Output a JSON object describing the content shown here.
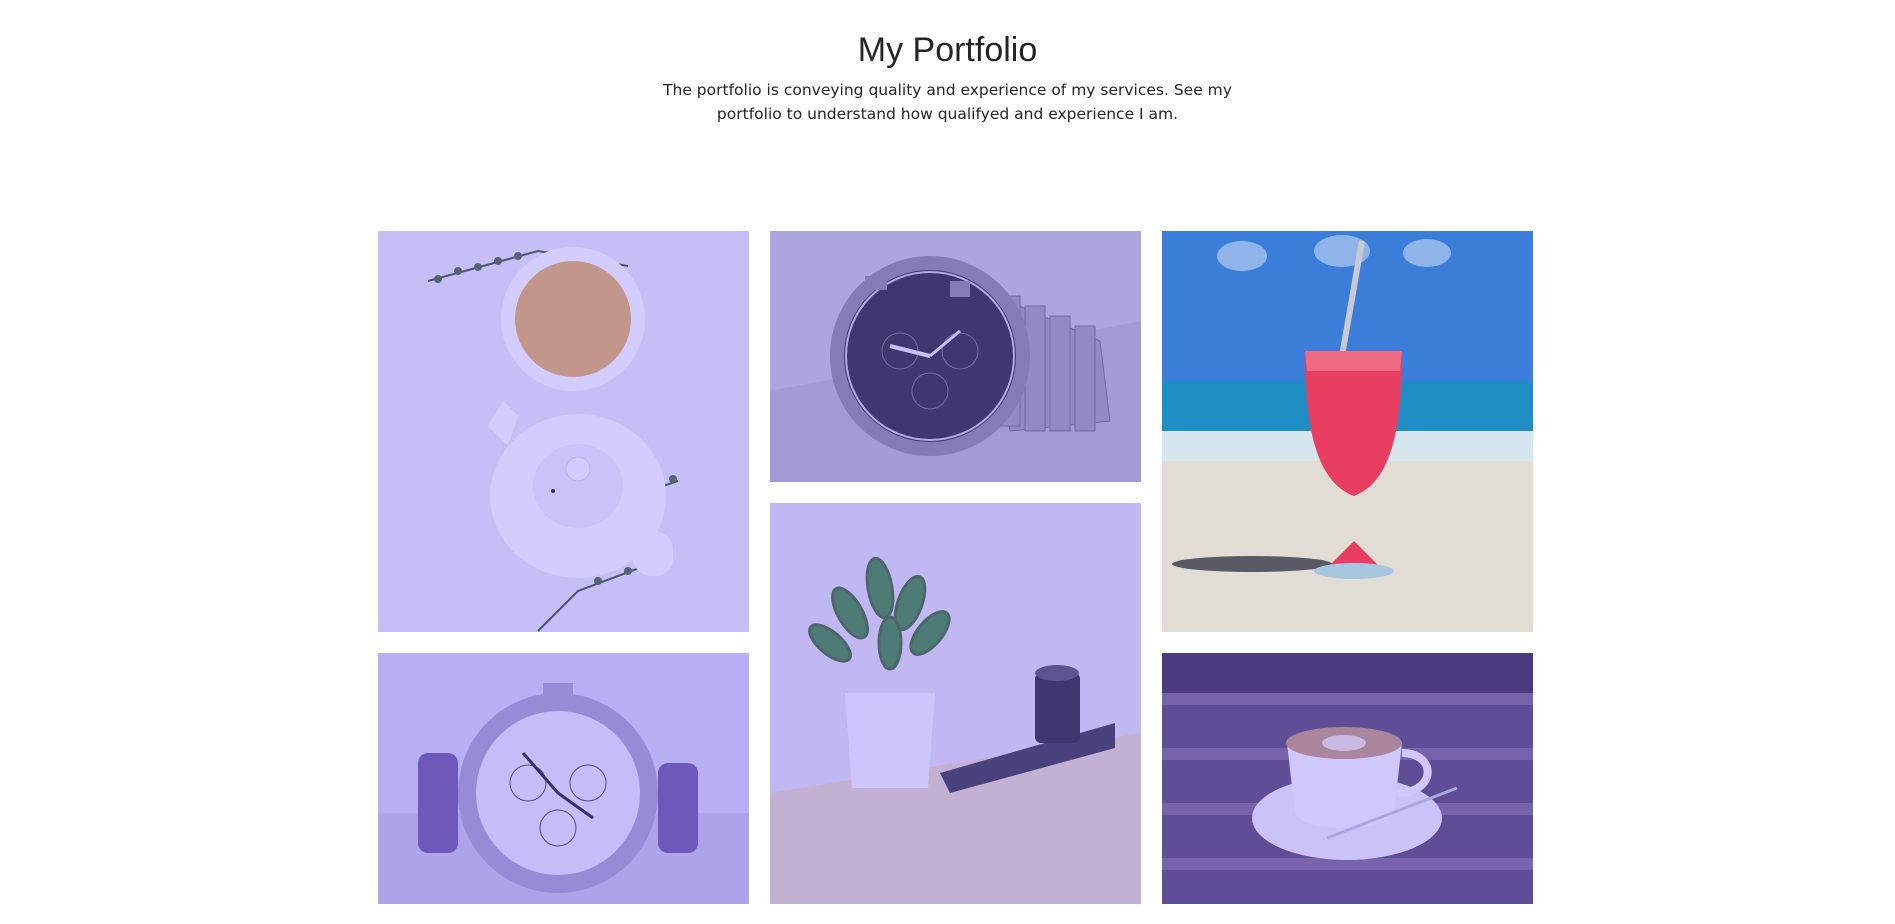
{
  "portfolio": {
    "title": "My Portfolio",
    "description": "The portfolio is conveying quality and experience of my services. See my portfolio to understand how qualifyed and experience I am."
  },
  "gallery": {
    "overlay_color": "#6d56ff",
    "items": [
      {
        "subject": "tea-cup-and-teapot"
      },
      {
        "subject": "chronograph-watch-black-dial"
      },
      {
        "subject": "red-cocktail-on-beach"
      },
      {
        "subject": "chronograph-watch-white-dial"
      },
      {
        "subject": "potted-plant-with-camera-lens"
      },
      {
        "subject": "coffee-cup-on-wooden-table"
      }
    ]
  }
}
